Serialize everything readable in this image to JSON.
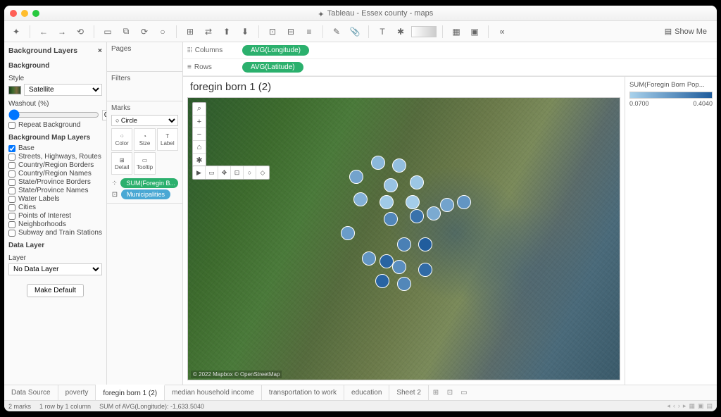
{
  "window": {
    "title": "Tableau - Essex county - maps"
  },
  "toolbar": {
    "show_me": "Show Me"
  },
  "bg_layers": {
    "title": "Background Layers",
    "background": "Background",
    "style_label": "Style",
    "style_value": "Satellite",
    "washout_label": "Washout (%)",
    "washout_value": "0",
    "repeat": "Repeat Background",
    "map_layers_title": "Background Map Layers",
    "layers": [
      {
        "label": "Base",
        "checked": true
      },
      {
        "label": "Streets, Highways, Routes",
        "checked": false
      },
      {
        "label": "Country/Region Borders",
        "checked": false
      },
      {
        "label": "Country/Region Names",
        "checked": false
      },
      {
        "label": "State/Province Borders",
        "checked": false
      },
      {
        "label": "State/Province Names",
        "checked": false
      },
      {
        "label": "Water Labels",
        "checked": false
      },
      {
        "label": "Cities",
        "checked": false
      },
      {
        "label": "Points of Interest",
        "checked": false
      },
      {
        "label": "Neighborhoods",
        "checked": false
      },
      {
        "label": "Subway and Train Stations",
        "checked": false
      }
    ],
    "data_layer_title": "Data Layer",
    "layer_label": "Layer",
    "layer_value": "No Data Layer",
    "make_default": "Make Default"
  },
  "cards": {
    "pages": "Pages",
    "filters": "Filters",
    "marks": "Marks",
    "mark_type": "○ Circle",
    "color": "Color",
    "size": "Size",
    "label": "Label",
    "detail": "Detail",
    "tooltip": "Tooltip",
    "pill1": "SUM(Foregin B...",
    "pill2": "Municipalities"
  },
  "shelves": {
    "columns": "Columns",
    "columns_pill": "AVG(Longitude)",
    "rows": "Rows",
    "rows_pill": "AVG(Latitude)"
  },
  "viz": {
    "title": "foregin born 1 (2)",
    "attribution": "© 2022 Mapbox © OpenStreetMap"
  },
  "legend": {
    "title": "SUM(Foregin Born Pop...",
    "min": "0.0700",
    "max": "0.4040"
  },
  "chart_data": {
    "type": "scatter",
    "title": "foregin born 1 (2)",
    "xlabel": "AVG(Longitude)",
    "ylabel": "AVG(Latitude)",
    "color_field": "SUM(Foregin Born Population)",
    "color_range": [
      0.07,
      0.404
    ],
    "series": [
      {
        "name": "Municipalities",
        "points": [
          {
            "x_pct": 44,
            "y_pct": 23,
            "v": 0.14
          },
          {
            "x_pct": 49,
            "y_pct": 24,
            "v": 0.12
          },
          {
            "x_pct": 39,
            "y_pct": 28,
            "v": 0.2
          },
          {
            "x_pct": 47,
            "y_pct": 31,
            "v": 0.11
          },
          {
            "x_pct": 53,
            "y_pct": 30,
            "v": 0.1
          },
          {
            "x_pct": 40,
            "y_pct": 36,
            "v": 0.16
          },
          {
            "x_pct": 46,
            "y_pct": 37,
            "v": 0.09
          },
          {
            "x_pct": 52,
            "y_pct": 37,
            "v": 0.08
          },
          {
            "x_pct": 47,
            "y_pct": 43,
            "v": 0.28
          },
          {
            "x_pct": 53,
            "y_pct": 42,
            "v": 0.34
          },
          {
            "x_pct": 57,
            "y_pct": 41,
            "v": 0.18
          },
          {
            "x_pct": 60,
            "y_pct": 38,
            "v": 0.2
          },
          {
            "x_pct": 64,
            "y_pct": 37,
            "v": 0.24
          },
          {
            "x_pct": 37,
            "y_pct": 48,
            "v": 0.22
          },
          {
            "x_pct": 50,
            "y_pct": 52,
            "v": 0.3
          },
          {
            "x_pct": 55,
            "y_pct": 52,
            "v": 0.4
          },
          {
            "x_pct": 42,
            "y_pct": 57,
            "v": 0.24
          },
          {
            "x_pct": 46,
            "y_pct": 58,
            "v": 0.38
          },
          {
            "x_pct": 49,
            "y_pct": 60,
            "v": 0.26
          },
          {
            "x_pct": 55,
            "y_pct": 61,
            "v": 0.36
          },
          {
            "x_pct": 45,
            "y_pct": 65,
            "v": 0.38
          },
          {
            "x_pct": 50,
            "y_pct": 66,
            "v": 0.28
          }
        ]
      }
    ]
  },
  "tabs": {
    "data_source": "Data Source",
    "items": [
      "poverty",
      "foregin born 1 (2)",
      "median household income",
      "transportation to work",
      "education",
      "Sheet 2"
    ],
    "active": 1
  },
  "status": {
    "marks": "2 marks",
    "rows_cols": "1 row by 1 column",
    "sum": "SUM of AVG(Longitude): -1,633.5040"
  }
}
